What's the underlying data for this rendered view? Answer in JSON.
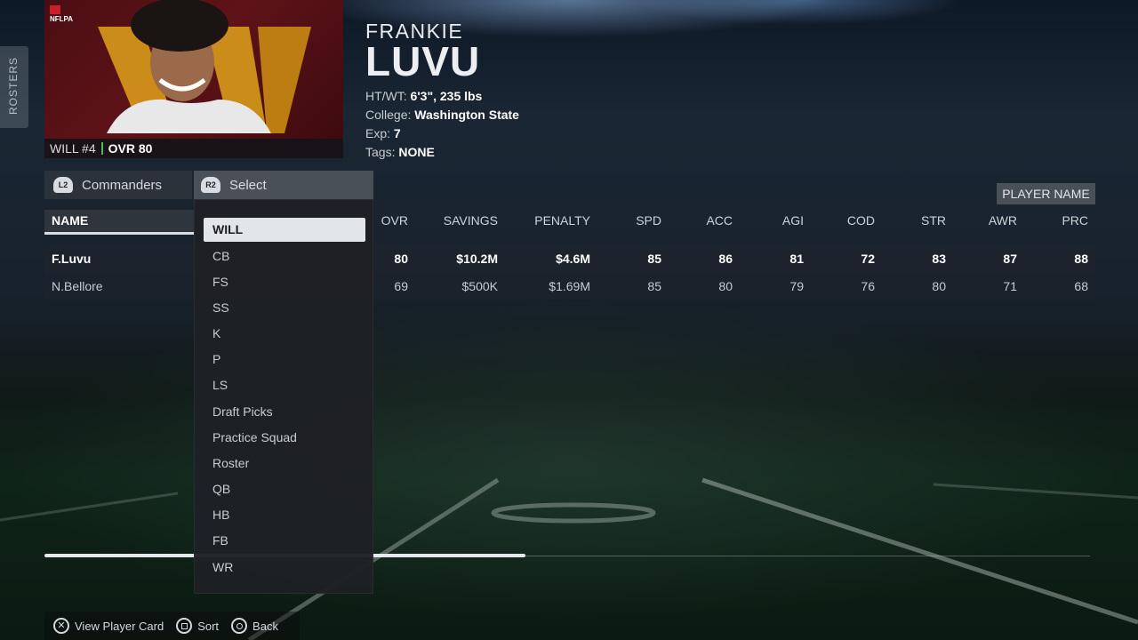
{
  "side_tab": {
    "label": "Rosters"
  },
  "player": {
    "logo_text": "NFLPA",
    "position_number": "WILL #4",
    "ovr": "OVR 80",
    "first_name": "FRANKIE",
    "last_name": "LUVU",
    "htwt_label": "HT/WT:",
    "htwt_value": "6'3\", 235 lbs",
    "college_label": "College:",
    "college_value": "Washington State",
    "exp_label": "Exp:",
    "exp_value": "7",
    "tags_label": "Tags:",
    "tags_value": "NONE"
  },
  "team_filter": {
    "button": "L2",
    "label": "Commanders"
  },
  "position_filter": {
    "button": "R2",
    "label": "Select"
  },
  "sort_label": "PLAYER NAME",
  "table": {
    "name_header": "NAME",
    "columns": [
      "OVR",
      "SAVINGS",
      "PENALTY",
      "SPD",
      "ACC",
      "AGI",
      "COD",
      "STR",
      "AWR",
      "PRC"
    ],
    "rows": [
      {
        "name": "F.Luvu",
        "values": [
          "80",
          "$10.2M",
          "$4.6M",
          "85",
          "86",
          "81",
          "72",
          "83",
          "87",
          "88"
        ]
      },
      {
        "name": "N.Bellore",
        "values": [
          "69",
          "$500K",
          "$1.69M",
          "85",
          "80",
          "79",
          "76",
          "80",
          "71",
          "68"
        ]
      }
    ]
  },
  "scroll_progress": 0.46,
  "dropdown": {
    "selected": "WILL",
    "items": [
      "WILL",
      "CB",
      "FS",
      "SS",
      "K",
      "P",
      "LS",
      "Draft Picks",
      "Practice Squad",
      "Roster",
      "QB",
      "HB",
      "FB",
      "WR"
    ]
  },
  "footer": {
    "view_card": "View Player Card",
    "sort": "Sort",
    "back": "Back"
  },
  "colors": {
    "accent_green": "#3fbf5a",
    "team_maroon": "#5e1318",
    "team_gold": "#e0a21a"
  }
}
